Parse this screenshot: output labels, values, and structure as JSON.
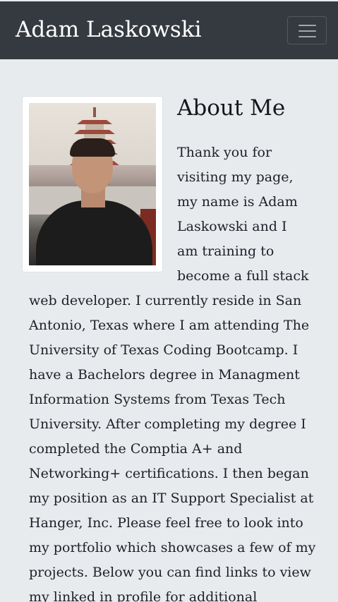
{
  "navbar": {
    "brand": "Adam Laskowski",
    "toggle_icon": "hamburger-menu-icon"
  },
  "about": {
    "heading": "About Me",
    "photo_icon": "profile-photo",
    "bio_lines": [
      "Thank you for",
      "visiting my page,",
      "my name is Adam",
      "Laskowski and I",
      "am training to",
      "become a full stack",
      "web developer. I currently reside in San",
      "Antonio, Texas where I am attending The",
      "University of Texas Coding Bootcamp. I",
      "have a Bachelors degree in Managment",
      "Information Systems from Texas Tech",
      "University. After completing my degree I",
      "completed the Comptia A+ and",
      "Networking+ certifications. I then began",
      "my position as an IT Support Specialist at",
      "Hanger, Inc. Please feel free to look into",
      "my portfolio which showcases a few of my",
      "projects. Below you can find links to view",
      "my linked in profile for additional"
    ]
  }
}
